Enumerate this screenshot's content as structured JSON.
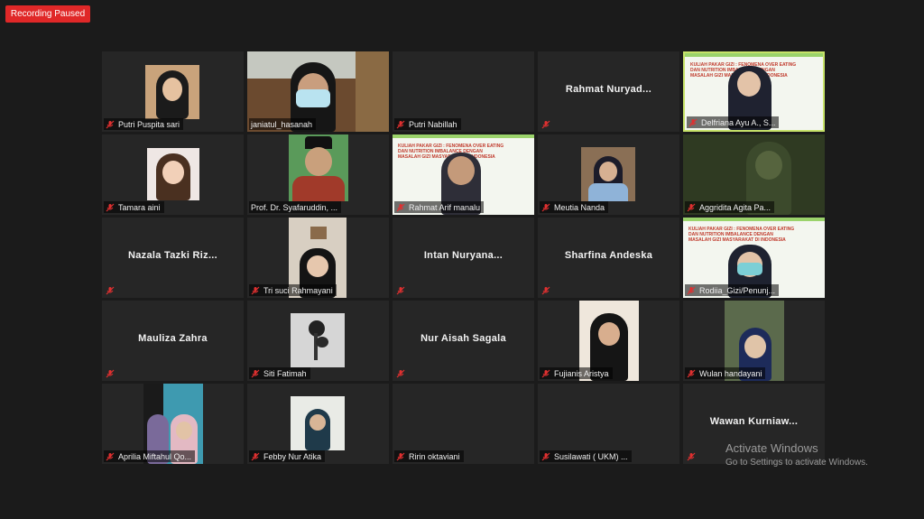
{
  "recording": {
    "label": "Recording Paused",
    "color": "#e02828"
  },
  "participants": [
    {
      "name": "Putri Puspita sari",
      "video": true
    },
    {
      "name": "janiatul_hasanah",
      "video": true
    },
    {
      "name": "Putri Nabillah",
      "video": false
    },
    {
      "name": "Rahmat  Nuryad...",
      "video": false,
      "label_hidden": true
    },
    {
      "name": "Delfriana Ayu A., S...",
      "video": true,
      "active_speaker": true
    },
    {
      "name": "Tamara aini",
      "video": true
    },
    {
      "name": "Prof. Dr. Syafaruddin, ...",
      "video": true
    },
    {
      "name": "Rahmat Arif manalu",
      "video": true
    },
    {
      "name": "Meutia Nanda",
      "video": true
    },
    {
      "name": "Aggridita Agita Pa...",
      "video": true
    },
    {
      "name": "Nazala  Tazki  Riz...",
      "video": false,
      "label_hidden": true
    },
    {
      "name": "Tri suci Rahmayani",
      "video": true
    },
    {
      "name": "Intan  Nuryana...",
      "video": false,
      "label_hidden": true
    },
    {
      "name": "Sharfina Andeska",
      "video": false,
      "label_hidden": true
    },
    {
      "name": "Rodiia_Gizi/Penunj...",
      "video": true
    },
    {
      "name": "Mauliza Zahra",
      "video": false,
      "label_hidden": true
    },
    {
      "name": "Siti Fatimah",
      "video": true
    },
    {
      "name": "Nur Aisah Sagala",
      "video": false,
      "label_hidden": true
    },
    {
      "name": "Fujianis Aristya",
      "video": true
    },
    {
      "name": "Wulan handayani",
      "video": true
    },
    {
      "name": "Aprilia Miftahul Qo...",
      "video": true
    },
    {
      "name": "Febby Nur Atika",
      "video": true
    },
    {
      "name": "Ririn oktaviani",
      "video": false
    },
    {
      "name": "Susilawati ( UKM) ...",
      "video": false
    },
    {
      "name": "Wawan  Kurniaw...",
      "video": false,
      "label_hidden": true
    }
  ],
  "slide_text": "KULIAH PAKAR GIZI : FENOMENA OVER EATING DAN NUTRITION IMBALANCE DENGAN MASALAH GIZI MASYARAKAT DI INDONESIA",
  "watermark": {
    "title": "Activate Windows",
    "subtitle": "Go to Settings to activate Windows."
  },
  "icons": {
    "muted": "mic-muted-icon"
  },
  "colors": {
    "active_border": "#c7e36a",
    "mute_icon": "#e03030"
  }
}
